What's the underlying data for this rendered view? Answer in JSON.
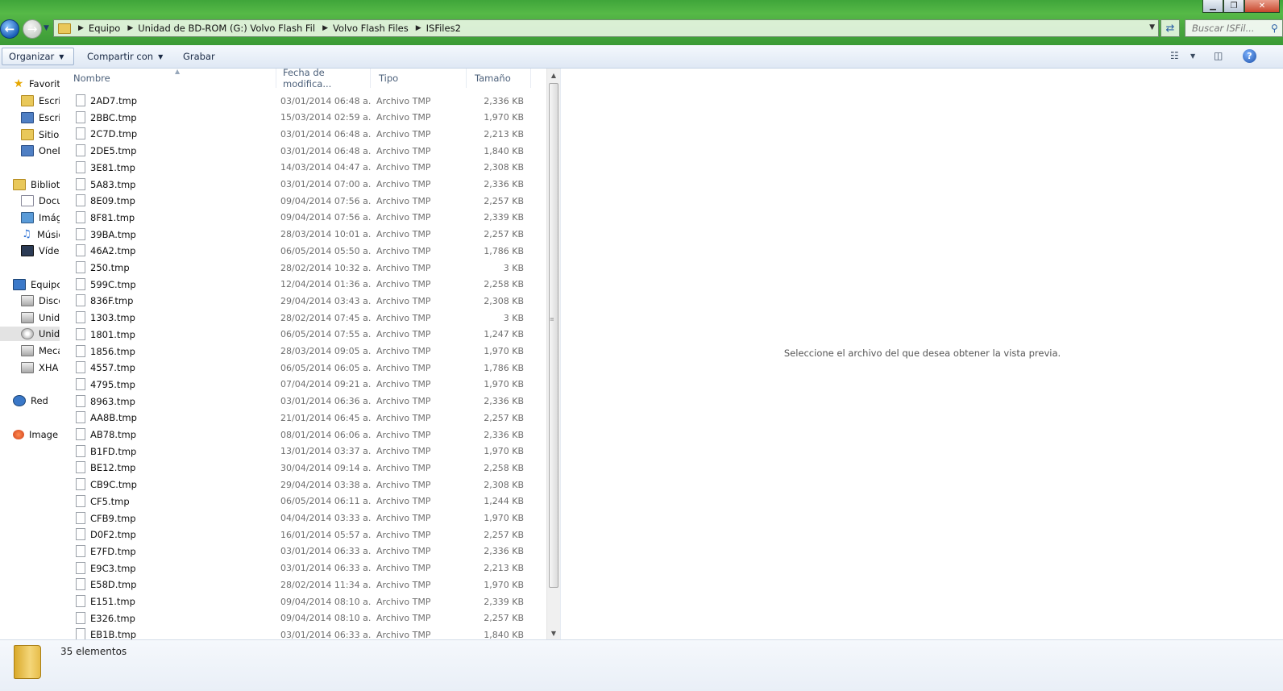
{
  "window": {
    "controls": {
      "minimize": "▁",
      "maximize": "❐",
      "close": "✕"
    }
  },
  "address": {
    "breadcrumbs": [
      "Equipo",
      "Unidad de BD-ROM (G:) Volvo Flash Fil",
      "Volvo Flash Files",
      "ISFiles2"
    ],
    "search_placeholder": "Buscar ISFil..."
  },
  "toolbar": {
    "organize": "Organizar",
    "share": "Compartir con",
    "burn": "Grabar"
  },
  "nav": {
    "items": [
      {
        "label": "Favoritos",
        "icon": "star-icon"
      },
      {
        "label": "Escritorio",
        "icon": "desktop-icon"
      },
      {
        "label": "Escritorio",
        "icon": "desktop-icon"
      },
      {
        "label": "Sitios",
        "icon": "folder-icon"
      },
      {
        "label": "OneDrive",
        "icon": "folder-icon"
      },
      {
        "label": "Bibliotecas",
        "icon": "library-icon"
      },
      {
        "label": "Documentos",
        "icon": "document-icon"
      },
      {
        "label": "Imágenes",
        "icon": "image-icon"
      },
      {
        "label": "Música",
        "icon": "music-icon"
      },
      {
        "label": "Vídeos",
        "icon": "video-icon"
      },
      {
        "label": "Equipo",
        "icon": "computer-icon"
      },
      {
        "label": "Disco local",
        "icon": "drive-icon"
      },
      {
        "label": "Unidad",
        "icon": "drive-icon"
      },
      {
        "label": "Unidad",
        "icon": "disc-icon"
      },
      {
        "label": "Mecánica",
        "icon": "drive-icon"
      },
      {
        "label": "XHA",
        "icon": "drive-icon"
      },
      {
        "label": "Red",
        "icon": "network-icon"
      },
      {
        "label": "Image",
        "icon": "app-icon"
      }
    ]
  },
  "columns": {
    "name": "Nombre",
    "date": "Fecha de modifica...",
    "type": "Tipo",
    "size": "Tamaño"
  },
  "files": [
    {
      "name": "2AD7.tmp",
      "date": "03/01/2014 06:48 a...",
      "type": "Archivo TMP",
      "size": "2,336 KB"
    },
    {
      "name": "2BBC.tmp",
      "date": "15/03/2014 02:59 a...",
      "type": "Archivo TMP",
      "size": "1,970 KB"
    },
    {
      "name": "2C7D.tmp",
      "date": "03/01/2014 06:48 a...",
      "type": "Archivo TMP",
      "size": "2,213 KB"
    },
    {
      "name": "2DE5.tmp",
      "date": "03/01/2014 06:48 a...",
      "type": "Archivo TMP",
      "size": "1,840 KB"
    },
    {
      "name": "3E81.tmp",
      "date": "14/03/2014 04:47 a...",
      "type": "Archivo TMP",
      "size": "2,308 KB"
    },
    {
      "name": "5A83.tmp",
      "date": "03/01/2014 07:00 a...",
      "type": "Archivo TMP",
      "size": "2,336 KB"
    },
    {
      "name": "8E09.tmp",
      "date": "09/04/2014 07:56 a...",
      "type": "Archivo TMP",
      "size": "2,257 KB"
    },
    {
      "name": "8F81.tmp",
      "date": "09/04/2014 07:56 a...",
      "type": "Archivo TMP",
      "size": "2,339 KB"
    },
    {
      "name": "39BA.tmp",
      "date": "28/03/2014 10:01 a...",
      "type": "Archivo TMP",
      "size": "2,257 KB"
    },
    {
      "name": "46A2.tmp",
      "date": "06/05/2014 05:50 a...",
      "type": "Archivo TMP",
      "size": "1,786 KB"
    },
    {
      "name": "250.tmp",
      "date": "28/02/2014 10:32 a...",
      "type": "Archivo TMP",
      "size": "3 KB"
    },
    {
      "name": "599C.tmp",
      "date": "12/04/2014 01:36 a...",
      "type": "Archivo TMP",
      "size": "2,258 KB"
    },
    {
      "name": "836F.tmp",
      "date": "29/04/2014 03:43 a...",
      "type": "Archivo TMP",
      "size": "2,308 KB"
    },
    {
      "name": "1303.tmp",
      "date": "28/02/2014 07:45 a...",
      "type": "Archivo TMP",
      "size": "3 KB"
    },
    {
      "name": "1801.tmp",
      "date": "06/05/2014 07:55 a...",
      "type": "Archivo TMP",
      "size": "1,247 KB"
    },
    {
      "name": "1856.tmp",
      "date": "28/03/2014 09:05 a...",
      "type": "Archivo TMP",
      "size": "1,970 KB"
    },
    {
      "name": "4557.tmp",
      "date": "06/05/2014 06:05 a...",
      "type": "Archivo TMP",
      "size": "1,786 KB"
    },
    {
      "name": "4795.tmp",
      "date": "07/04/2014 09:21 a...",
      "type": "Archivo TMP",
      "size": "1,970 KB"
    },
    {
      "name": "8963.tmp",
      "date": "03/01/2014 06:36 a...",
      "type": "Archivo TMP",
      "size": "2,336 KB"
    },
    {
      "name": "AA8B.tmp",
      "date": "21/01/2014 06:45 a...",
      "type": "Archivo TMP",
      "size": "2,257 KB"
    },
    {
      "name": "AB78.tmp",
      "date": "08/01/2014 06:06 a...",
      "type": "Archivo TMP",
      "size": "2,336 KB"
    },
    {
      "name": "B1FD.tmp",
      "date": "13/01/2014 03:37 a...",
      "type": "Archivo TMP",
      "size": "1,970 KB"
    },
    {
      "name": "BE12.tmp",
      "date": "30/04/2014 09:14 a...",
      "type": "Archivo TMP",
      "size": "2,258 KB"
    },
    {
      "name": "CB9C.tmp",
      "date": "29/04/2014 03:38 a...",
      "type": "Archivo TMP",
      "size": "2,308 KB"
    },
    {
      "name": "CF5.tmp",
      "date": "06/05/2014 06:11 a...",
      "type": "Archivo TMP",
      "size": "1,244 KB"
    },
    {
      "name": "CFB9.tmp",
      "date": "04/04/2014 03:33 a...",
      "type": "Archivo TMP",
      "size": "1,970 KB"
    },
    {
      "name": "D0F2.tmp",
      "date": "16/01/2014 05:57 a...",
      "type": "Archivo TMP",
      "size": "2,257 KB"
    },
    {
      "name": "E7FD.tmp",
      "date": "03/01/2014 06:33 a...",
      "type": "Archivo TMP",
      "size": "2,336 KB"
    },
    {
      "name": "E9C3.tmp",
      "date": "03/01/2014 06:33 a...",
      "type": "Archivo TMP",
      "size": "2,213 KB"
    },
    {
      "name": "E58D.tmp",
      "date": "28/02/2014 11:34 a...",
      "type": "Archivo TMP",
      "size": "1,970 KB"
    },
    {
      "name": "E151.tmp",
      "date": "09/04/2014 08:10 a...",
      "type": "Archivo TMP",
      "size": "2,339 KB"
    },
    {
      "name": "E326.tmp",
      "date": "09/04/2014 08:10 a...",
      "type": "Archivo TMP",
      "size": "2,257 KB"
    },
    {
      "name": "EB1B.tmp",
      "date": "03/01/2014 06:33 a...",
      "type": "Archivo TMP",
      "size": "1,840 KB"
    }
  ],
  "preview": {
    "message": "Seleccione el archivo del que desea obtener la vista previa."
  },
  "status": {
    "item_count": "35 elementos"
  }
}
